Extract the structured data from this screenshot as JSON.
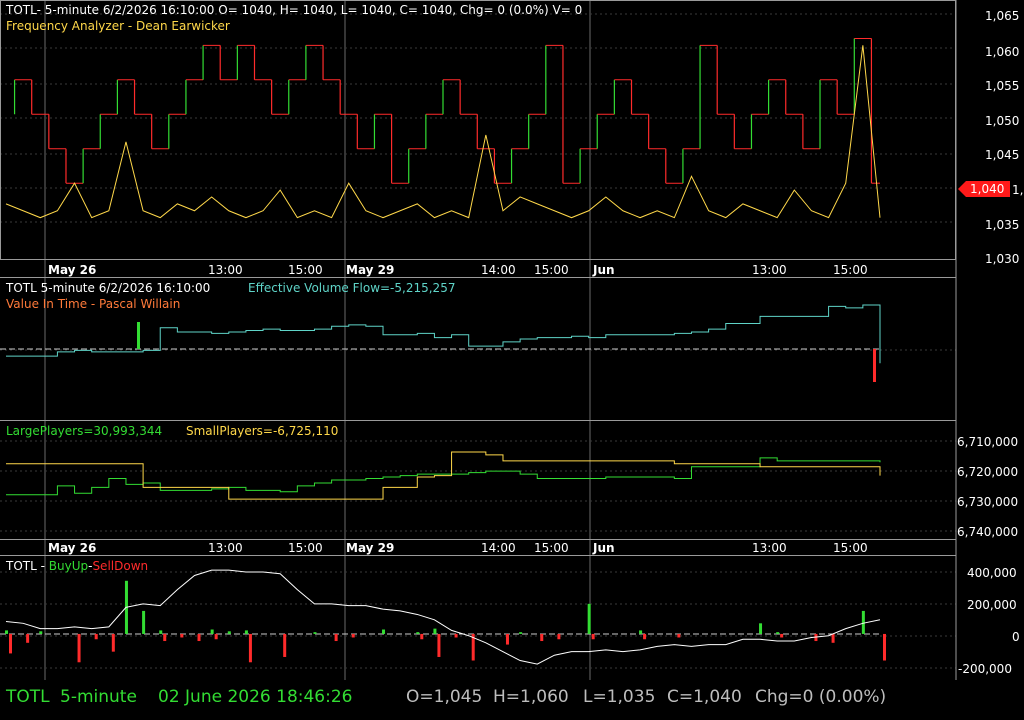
{
  "colors": {
    "background": "#000000",
    "grid": "#3a3a3a",
    "frame": "#9a9a9a",
    "text": "#ffffff",
    "red": "#ff2b2b",
    "green": "#33dd33",
    "yellow": "#ffd84a",
    "cyan": "#5fd4c8",
    "white": "#ffffff",
    "price_tag": "#ff1a1a"
  },
  "chart_data": [
    {
      "type": "line",
      "panel": "price",
      "header": "TOTL- 5-minute 6/2/2026 16:10:00 O= 1040, H= 1040, L= 1040, C= 1040, Chg= 0 (0.0%) V= 0",
      "indicator_title": "Frequency Analyzer - Dean Earwicker",
      "y_ticks": [
        "1,065",
        "1,060",
        "1,055",
        "1,050",
        "1,045",
        "1,040",
        "1,035",
        "1,030"
      ],
      "ylim": [
        1029,
        1066
      ],
      "price_tag": "1,040",
      "series": [
        {
          "values": [
            1050,
            1055,
            1050,
            1045,
            1040,
            1045,
            1050,
            1055,
            1050,
            1045,
            1050,
            1055,
            1060,
            1055,
            1060,
            1055,
            1050,
            1055,
            1060,
            1055,
            1050,
            1045,
            1050,
            1040,
            1045,
            1050,
            1055,
            1050,
            1045,
            1040,
            1045,
            1050,
            1060,
            1040,
            1045,
            1050,
            1055,
            1050,
            1045,
            1040,
            1045,
            1060,
            1050,
            1045,
            1050,
            1055,
            1050,
            1045,
            1055,
            1050,
            1061,
            1040
          ]
        },
        {
          "values": [
            1037,
            1036,
            1035,
            1036,
            1040,
            1035,
            1036,
            1046,
            1036,
            1035,
            1037,
            1036,
            1038,
            1036,
            1035,
            1036,
            1039,
            1035,
            1036,
            1035,
            1040,
            1036,
            1035,
            1036,
            1037,
            1035,
            1036,
            1035,
            1047,
            1036,
            1038,
            1037,
            1036,
            1035,
            1036,
            1038,
            1036,
            1035,
            1036,
            1035,
            1041,
            1036,
            1035,
            1037,
            1036,
            1035,
            1039,
            1036,
            1035,
            1040,
            1060,
            1035
          ]
        }
      ]
    },
    {
      "type": "line",
      "panel": "volume-flow",
      "header_left": "TOTL 5-minute  6/2/2026 16:10:00",
      "header_value": "Effective Volume Flow=-5,215,257",
      "indicator_title": "Value In Time - Pascal Willain",
      "series": [
        {
          "name": "Effective Volume Flow",
          "values": [
            0.45,
            0.45,
            0.45,
            0.48,
            0.49,
            0.48,
            0.48,
            0.48,
            0.49,
            0.65,
            0.62,
            0.62,
            0.61,
            0.62,
            0.63,
            0.64,
            0.63,
            0.63,
            0.64,
            0.66,
            0.67,
            0.66,
            0.6,
            0.6,
            0.61,
            0.58,
            0.6,
            0.52,
            0.52,
            0.55,
            0.57,
            0.58,
            0.58,
            0.59,
            0.58,
            0.6,
            0.6,
            0.6,
            0.6,
            0.61,
            0.62,
            0.64,
            0.68,
            0.68,
            0.73,
            0.73,
            0.73,
            0.73,
            0.8,
            0.79,
            0.81,
            0.4
          ]
        }
      ]
    },
    {
      "type": "line",
      "panel": "players",
      "large_label": "LargePlayers=30,993,344",
      "small_label": "SmallPlayers=-6,725,110",
      "y_ticks": [
        "6,710,000",
        "6,720,000",
        "6,730,000",
        "6,740,000"
      ],
      "ylim": [
        6705000,
        6745000
      ],
      "series": [
        {
          "name": "LargePlayers",
          "values": [
            6730000,
            6730000,
            6730000,
            6727000,
            6729500,
            6727500,
            6724500,
            6726500,
            6726000,
            6728500,
            6728500,
            6728500,
            6728000,
            6727500,
            6728500,
            6728500,
            6729000,
            6727000,
            6726000,
            6725000,
            6725000,
            6724500,
            6724000,
            6723500,
            6723000,
            6723000,
            6723000,
            6722500,
            6722000,
            6722000,
            6723000,
            6724500,
            6724500,
            6724500,
            6724500,
            6724000,
            6724000,
            6724000,
            6724000,
            6724500,
            6720500,
            6720500,
            6720500,
            6720500,
            6717500,
            6718500,
            6718500,
            6718500,
            6718500,
            6718500,
            6718500,
            6719000
          ]
        },
        {
          "name": "SmallPlayers",
          "values": [
            6719500,
            6719500,
            6719500,
            6719500,
            6719500,
            6719500,
            6719500,
            6719500,
            6727500,
            6727500,
            6727500,
            6727500,
            6727500,
            6731500,
            6731500,
            6731500,
            6731500,
            6731500,
            6731500,
            6731500,
            6731500,
            6731500,
            6727500,
            6727500,
            6724000,
            6723500,
            6715500,
            6715500,
            6716500,
            6718500,
            6718500,
            6718500,
            6718500,
            6718500,
            6718500,
            6718500,
            6718500,
            6718500,
            6718500,
            6719500,
            6719500,
            6719500,
            6719500,
            6719500,
            6720500,
            6720500,
            6720500,
            6720500,
            6720500,
            6720500,
            6720500,
            6723500
          ]
        }
      ]
    },
    {
      "type": "bar",
      "panel": "buyup-selldown",
      "title_prefix": "TOTL - ",
      "title_buy": "BuyUp",
      "title_sep": "-",
      "title_sell": "SellDown",
      "y_ticks": [
        "400,000",
        "200,000",
        "0",
        "-200,000"
      ],
      "ylim": [
        -260000,
        440000
      ],
      "series": [
        {
          "name": "BuyUp",
          "values": [
            20000,
            0,
            15000,
            0,
            0,
            0,
            0,
            300000,
            130000,
            20000,
            0,
            0,
            25000,
            15000,
            20000,
            0,
            0,
            0,
            10000,
            0,
            0,
            0,
            25000,
            0,
            10000,
            30000,
            0,
            0,
            0,
            0,
            10000,
            0,
            0,
            0,
            170000,
            0,
            0,
            20000,
            0,
            0,
            0,
            0,
            0,
            0,
            60000,
            10000,
            0,
            0,
            0,
            0,
            130000,
            0
          ]
        },
        {
          "name": "SellDown",
          "values": [
            -110000,
            -50000,
            0,
            0,
            -160000,
            -30000,
            -100000,
            0,
            0,
            -40000,
            -20000,
            -40000,
            -30000,
            0,
            -160000,
            0,
            -130000,
            0,
            0,
            -40000,
            -20000,
            0,
            0,
            0,
            -30000,
            -130000,
            -20000,
            -150000,
            0,
            -60000,
            0,
            -40000,
            -30000,
            0,
            -30000,
            0,
            0,
            -30000,
            0,
            -20000,
            0,
            0,
            0,
            0,
            0,
            -20000,
            0,
            -40000,
            -50000,
            0,
            0,
            -150000
          ]
        },
        {
          "name": "Line",
          "values": [
            70000,
            60000,
            30000,
            30000,
            40000,
            30000,
            40000,
            150000,
            170000,
            160000,
            250000,
            330000,
            360000,
            360000,
            350000,
            350000,
            340000,
            250000,
            170000,
            170000,
            160000,
            160000,
            140000,
            130000,
            110000,
            80000,
            20000,
            -10000,
            -50000,
            -100000,
            -150000,
            -170000,
            -120000,
            -100000,
            -100000,
            -90000,
            -100000,
            -90000,
            -70000,
            -60000,
            -70000,
            -60000,
            -60000,
            -30000,
            -30000,
            -40000,
            -40000,
            -20000,
            -10000,
            30000,
            60000,
            80000
          ]
        }
      ]
    }
  ],
  "time_axis": {
    "date_labels": [
      "May 26",
      "May 29",
      "Jun"
    ],
    "time_labels": [
      "13:00",
      "15:00",
      "14:00",
      "15:00",
      "13:00",
      "15:00"
    ]
  },
  "status_bar": {
    "symbol": "TOTL",
    "interval": "5-minute",
    "datetime": "02 June 2026 18:46:26",
    "open": "O=1,045",
    "high": "H=1,060",
    "low": "L=1,035",
    "close": "C=1,040",
    "change": "Chg=0 (0.00%)"
  }
}
